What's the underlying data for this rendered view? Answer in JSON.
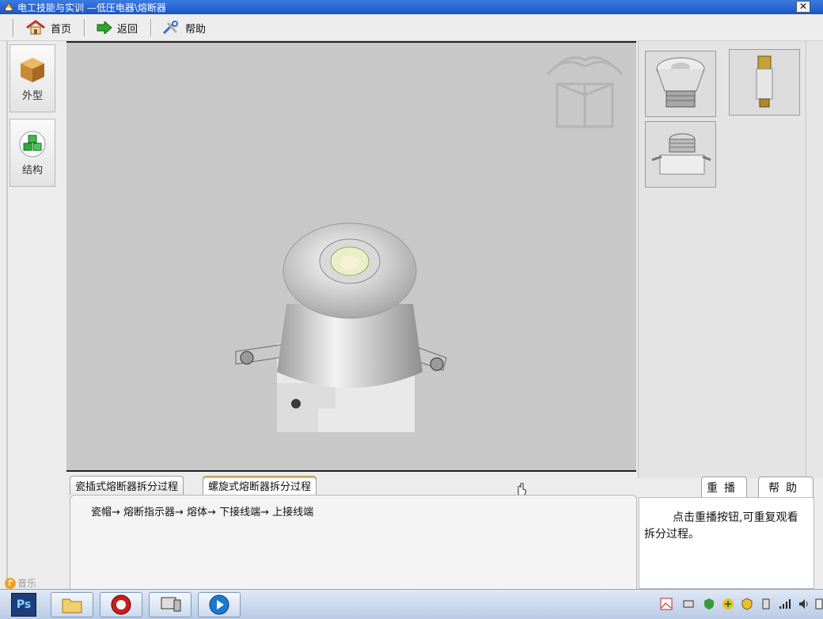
{
  "titlebar": {
    "title": "电工技能与实训 —低压电器\\熔断器",
    "close": "✕"
  },
  "toolbar": {
    "home": "首页",
    "back": "返回",
    "help": "帮助"
  },
  "sidebar": {
    "items": [
      {
        "label": "外型"
      },
      {
        "label": "结构"
      }
    ]
  },
  "tabs": [
    {
      "label": "瓷插式熔断器拆分过程"
    },
    {
      "label": "螺旋式熔断器拆分过程",
      "active": true
    }
  ],
  "process_text": "瓷帽→ 熔断指示器→ 熔体→ 下接线端→ 上接线端",
  "right_tabs": {
    "replay": "重播",
    "help": "帮助"
  },
  "help_text": "点击重播按钮,可重复观看拆分过程。",
  "music": "音乐",
  "colors": {
    "stage_bg": "#c8c8c8",
    "titlebar": "#1a55c8"
  }
}
